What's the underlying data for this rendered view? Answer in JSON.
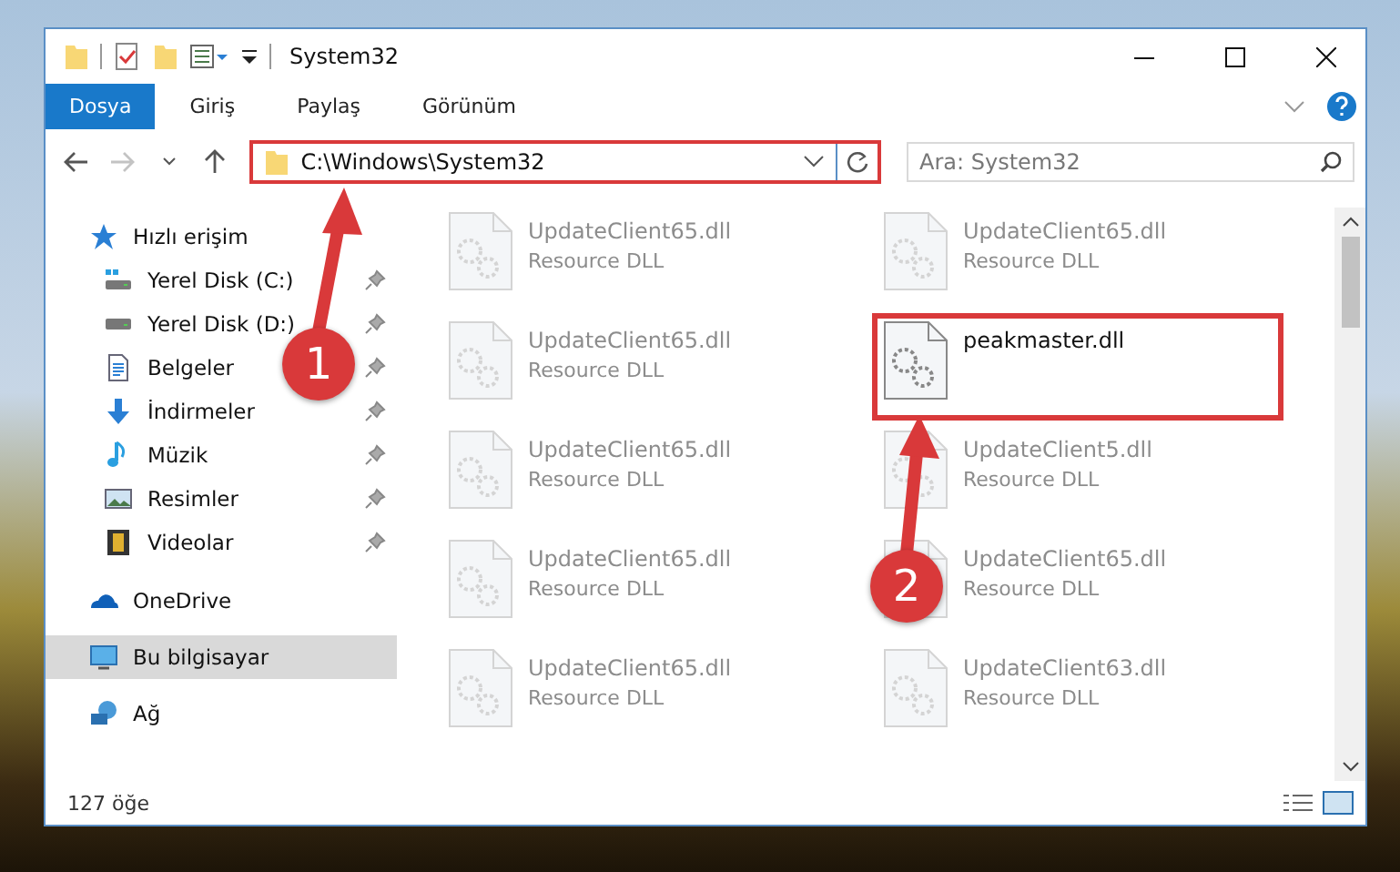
{
  "window": {
    "title": "System32"
  },
  "ribbon_tabs": [
    {
      "label": "Dosya",
      "selected": true
    },
    {
      "label": "Giriş",
      "selected": false
    },
    {
      "label": "Paylaş",
      "selected": false
    },
    {
      "label": "Görünüm",
      "selected": false
    }
  ],
  "address_bar": {
    "path": "C:\\Windows\\System32",
    "highlighted": true
  },
  "search": {
    "placeholder": "Ara: System32"
  },
  "sidebar": {
    "items": [
      {
        "label": "Hızlı erişim",
        "kind": "star",
        "selected": false,
        "children": [
          {
            "label": "Yerel Disk (C:)",
            "kind": "windrive",
            "pinned": true,
            "selected": false
          },
          {
            "label": "Yerel Disk (D:)",
            "kind": "drive",
            "pinned": true,
            "selected": false
          },
          {
            "label": "Belgeler",
            "kind": "document",
            "pinned": true,
            "selected": false
          },
          {
            "label": "İndirmeler",
            "kind": "download",
            "pinned": true,
            "selected": false
          },
          {
            "label": "Müzik",
            "kind": "music",
            "pinned": true,
            "selected": false
          },
          {
            "label": "Resimler",
            "kind": "picture",
            "pinned": true,
            "selected": false
          },
          {
            "label": "Videolar",
            "kind": "film",
            "pinned": true,
            "selected": false
          }
        ]
      },
      {
        "label": "OneDrive",
        "kind": "cloud",
        "selected": false
      },
      {
        "label": "Bu bilgisayar",
        "kind": "computer",
        "selected": true
      },
      {
        "label": "Ağ",
        "kind": "network",
        "selected": false
      }
    ]
  },
  "files": [
    {
      "name": "UpdateClient65.dll",
      "type": "Resource DLL",
      "blurred": true,
      "highlighted": false
    },
    {
      "name": "UpdateClient65.dll",
      "type": "Resource DLL",
      "blurred": true,
      "highlighted": false
    },
    {
      "name": "UpdateClient65.dll",
      "type": "Resource DLL",
      "blurred": true,
      "highlighted": false
    },
    {
      "name": "peakmaster.dll",
      "blurred": false,
      "highlighted": true
    },
    {
      "name": "UpdateClient65.dll",
      "type": "Resource DLL",
      "blurred": true,
      "highlighted": false
    },
    {
      "name": "UpdateClient5.dll",
      "type": "Resource DLL",
      "blurred": true,
      "highlighted": false
    },
    {
      "name": "UpdateClient65.dll",
      "type": "Resource DLL",
      "blurred": true,
      "highlighted": false
    },
    {
      "name": "UpdateClient65.dll",
      "type": "Resource DLL",
      "blurred": true,
      "highlighted": false
    },
    {
      "name": "UpdateClient65.dll",
      "type": "Resource DLL",
      "blurred": true,
      "highlighted": false
    },
    {
      "name": "UpdateClient63.dll",
      "type": "Resource DLL",
      "blurred": true,
      "highlighted": false
    }
  ],
  "callouts": [
    {
      "number": "1"
    },
    {
      "number": "2"
    }
  ],
  "status_bar": {
    "count": "127 öğe"
  }
}
